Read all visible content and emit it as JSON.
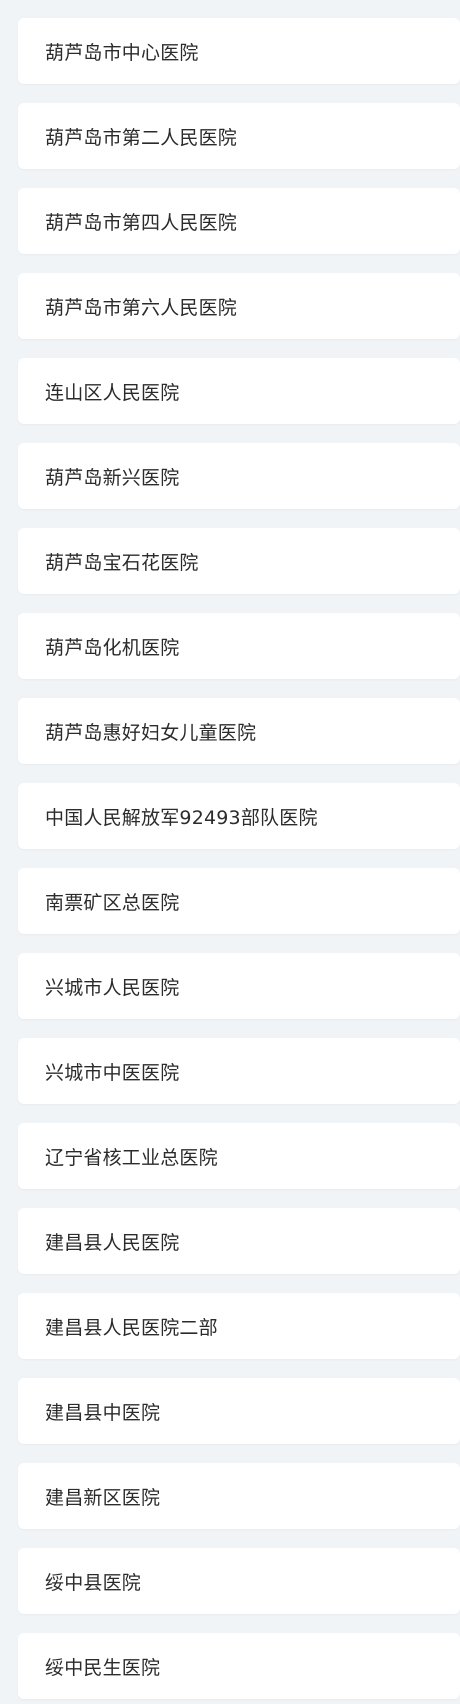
{
  "hospitals": [
    "葫芦岛市中心医院",
    "葫芦岛市第二人民医院",
    "葫芦岛市第四人民医院",
    "葫芦岛市第六人民医院",
    "连山区人民医院",
    "葫芦岛新兴医院",
    "葫芦岛宝石花医院",
    "葫芦岛化机医院",
    "葫芦岛惠好妇女儿童医院",
    "中国人民解放军92493部队医院",
    "南票矿区总医院",
    "兴城市人民医院",
    "兴城市中医医院",
    "辽宁省核工业总医院",
    "建昌县人民医院",
    "建昌县人民医院二部",
    "建昌县中医院",
    "建昌新区医院",
    "绥中县医院",
    "绥中民生医院"
  ]
}
